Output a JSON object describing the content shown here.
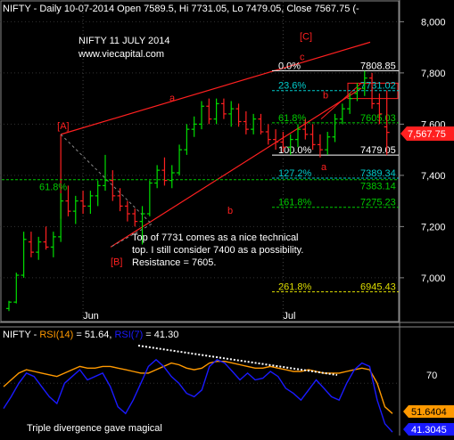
{
  "header": {
    "title": "NIFTY - Daily 10-07-2014 Open 7589.5, Hi 7731.05, Lo 7479.05, Close 7567.75 (-"
  },
  "chart_title": {
    "line1": "NIFTY 11 JULY 2014",
    "line2": "www.viecapital.com"
  },
  "annotation": {
    "lines": [
      "Top of 7731 comes as a nice technical",
      "top. I still consider 7400 as a possibility.",
      "Resistance = 7605."
    ]
  },
  "colors": {
    "bg": "#000000",
    "up": "#00dd00",
    "down": "#ff2020",
    "trend": "#ff2020",
    "fib": "#ffffff",
    "fib_green": "#00cc00",
    "fib_cyan": "#00cccc",
    "fib_yellow": "#dddd00",
    "rsi14": "#ff9900",
    "rsi7": "#1a1aff"
  },
  "chart_data": [
    {
      "type": "candlestick",
      "ylim": [
        6850,
        8050
      ],
      "y_ticks": [
        "7,000",
        "7,200",
        "7,400",
        "7,600",
        "7,800",
        "8,000"
      ],
      "x_labels": [
        "Jun",
        "Jul"
      ],
      "last_price_label": "7,567.75",
      "wave_labels": [
        "[A]",
        "[B]",
        "[C]",
        "a",
        "b",
        "c",
        "b",
        "a"
      ],
      "fib_levels": [
        {
          "pct": "0.0%",
          "value": "7808.85",
          "level": 7808.85
        },
        {
          "pct": "23.6%",
          "value": "7731.02",
          "level": 7731.02
        },
        {
          "pct": "61.8%",
          "value": "7605.03",
          "level": 7605.03
        },
        {
          "pct": "100.0%",
          "value": "7479.05",
          "level": 7479.05
        },
        {
          "pct": "127.2%",
          "value": "7389.34",
          "level": 7389.34
        },
        {
          "pct": "161.8%",
          "value": "7275.23",
          "level": 7275.23
        },
        {
          "pct": "261.8%",
          "value": "6945.43",
          "level": 6945.43
        }
      ],
      "extra_level": {
        "pct": "61.8%",
        "value": "7383.14",
        "level": 7383.14
      },
      "candles": [
        {
          "o": 6880,
          "h": 6910,
          "l": 6870,
          "c": 6905
        },
        {
          "o": 6905,
          "h": 7020,
          "l": 6900,
          "c": 7010
        },
        {
          "o": 7010,
          "h": 7180,
          "l": 7000,
          "c": 7150
        },
        {
          "o": 7140,
          "h": 7180,
          "l": 7080,
          "c": 7100
        },
        {
          "o": 7100,
          "h": 7160,
          "l": 7070,
          "c": 7140
        },
        {
          "o": 7140,
          "h": 7200,
          "l": 7110,
          "c": 7120
        },
        {
          "o": 7120,
          "h": 7180,
          "l": 7080,
          "c": 7160
        },
        {
          "o": 7160,
          "h": 7330,
          "l": 7140,
          "c": 7300
        },
        {
          "o": 7300,
          "h": 7360,
          "l": 7240,
          "c": 7260
        },
        {
          "o": 7260,
          "h": 7320,
          "l": 7210,
          "c": 7300
        },
        {
          "o": 7300,
          "h": 7340,
          "l": 7250,
          "c": 7280
        },
        {
          "o": 7280,
          "h": 7340,
          "l": 7250,
          "c": 7320
        },
        {
          "o": 7320,
          "h": 7380,
          "l": 7280,
          "c": 7360
        },
        {
          "o": 7360,
          "h": 7480,
          "l": 7340,
          "c": 7380
        },
        {
          "o": 7380,
          "h": 7420,
          "l": 7300,
          "c": 7320
        },
        {
          "o": 7320,
          "h": 7350,
          "l": 7260,
          "c": 7280
        },
        {
          "o": 7280,
          "h": 7300,
          "l": 7220,
          "c": 7250
        },
        {
          "o": 7250,
          "h": 7270,
          "l": 7200,
          "c": 7220
        },
        {
          "o": 7220,
          "h": 7280,
          "l": 7130,
          "c": 7250
        },
        {
          "o": 7250,
          "h": 7380,
          "l": 7240,
          "c": 7370
        },
        {
          "o": 7370,
          "h": 7440,
          "l": 7350,
          "c": 7420
        },
        {
          "o": 7420,
          "h": 7470,
          "l": 7360,
          "c": 7380
        },
        {
          "o": 7380,
          "h": 7440,
          "l": 7350,
          "c": 7410
        },
        {
          "o": 7410,
          "h": 7520,
          "l": 7400,
          "c": 7500
        },
        {
          "o": 7500,
          "h": 7600,
          "l": 7480,
          "c": 7580
        },
        {
          "o": 7580,
          "h": 7630,
          "l": 7550,
          "c": 7600
        },
        {
          "o": 7600,
          "h": 7690,
          "l": 7580,
          "c": 7670
        },
        {
          "o": 7670,
          "h": 7700,
          "l": 7600,
          "c": 7620
        },
        {
          "o": 7620,
          "h": 7700,
          "l": 7600,
          "c": 7680
        },
        {
          "o": 7680,
          "h": 7700,
          "l": 7620,
          "c": 7640
        },
        {
          "o": 7640,
          "h": 7690,
          "l": 7590,
          "c": 7660
        },
        {
          "o": 7660,
          "h": 7680,
          "l": 7590,
          "c": 7610
        },
        {
          "o": 7610,
          "h": 7650,
          "l": 7560,
          "c": 7580
        },
        {
          "o": 7580,
          "h": 7640,
          "l": 7560,
          "c": 7620
        },
        {
          "o": 7620,
          "h": 7640,
          "l": 7560,
          "c": 7570
        },
        {
          "o": 7570,
          "h": 7600,
          "l": 7520,
          "c": 7540
        },
        {
          "o": 7540,
          "h": 7580,
          "l": 7500,
          "c": 7530
        },
        {
          "o": 7530,
          "h": 7570,
          "l": 7490,
          "c": 7510
        },
        {
          "o": 7510,
          "h": 7560,
          "l": 7480,
          "c": 7540
        },
        {
          "o": 7540,
          "h": 7600,
          "l": 7510,
          "c": 7580
        },
        {
          "o": 7580,
          "h": 7620,
          "l": 7540,
          "c": 7560
        },
        {
          "o": 7560,
          "h": 7600,
          "l": 7500,
          "c": 7520
        },
        {
          "o": 7520,
          "h": 7560,
          "l": 7470,
          "c": 7500
        },
        {
          "o": 7500,
          "h": 7570,
          "l": 7480,
          "c": 7550
        },
        {
          "o": 7550,
          "h": 7640,
          "l": 7530,
          "c": 7620
        },
        {
          "o": 7620,
          "h": 7680,
          "l": 7600,
          "c": 7660
        },
        {
          "o": 7660,
          "h": 7720,
          "l": 7640,
          "c": 7700
        },
        {
          "o": 7720,
          "h": 7760,
          "l": 7690,
          "c": 7740
        },
        {
          "o": 7740,
          "h": 7808,
          "l": 7710,
          "c": 7780
        },
        {
          "o": 7780,
          "h": 7800,
          "l": 7660,
          "c": 7680
        },
        {
          "o": 7680,
          "h": 7720,
          "l": 7600,
          "c": 7640
        },
        {
          "o": 7589.5,
          "h": 7731.05,
          "l": 7479.05,
          "c": 7567.75
        }
      ]
    },
    {
      "type": "line",
      "title_prefix": "NIFTY - ",
      "rsi14_label": "RSI(14)",
      "rsi14_value": "51.64",
      "rsi7_label": "RSI(7)",
      "rsi7_value": "41.30",
      "ylim": [
        40,
        95
      ],
      "y_tick": "70",
      "rsi14_box": "51.6404",
      "rsi7_box": "41.3045",
      "note": "Triple divergence gave magical",
      "series": [
        {
          "name": "RSI(14)",
          "values": [
            68,
            72,
            76,
            78,
            77,
            76,
            75,
            74,
            76,
            78,
            80,
            79,
            79,
            80,
            80,
            79,
            78,
            77,
            76,
            76,
            78,
            80,
            82,
            81,
            79,
            78,
            79,
            82,
            83,
            83,
            82,
            81,
            80,
            79,
            79,
            80,
            79,
            78,
            77,
            77,
            78,
            77,
            76,
            76,
            76,
            77,
            78,
            79,
            78,
            70,
            56,
            52
          ]
        },
        {
          "name": "RSI(7)",
          "values": [
            55,
            62,
            70,
            76,
            74,
            68,
            62,
            58,
            70,
            74,
            78,
            72,
            74,
            76,
            68,
            56,
            52,
            60,
            70,
            80,
            84,
            80,
            74,
            70,
            64,
            62,
            66,
            80,
            84,
            82,
            77,
            72,
            76,
            72,
            73,
            77,
            74,
            67,
            64,
            60,
            66,
            72,
            67,
            62,
            60,
            70,
            78,
            82,
            80,
            60,
            46,
            41
          ]
        }
      ]
    }
  ]
}
